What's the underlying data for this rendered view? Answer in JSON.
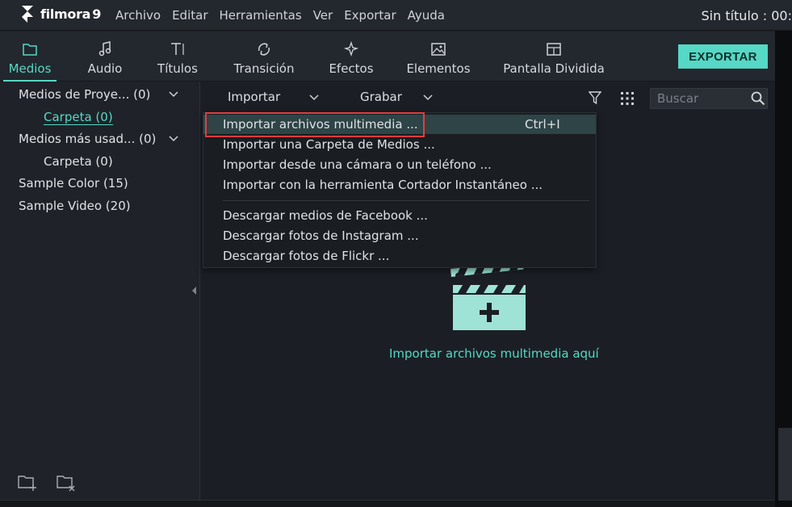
{
  "app": {
    "logo_text": "filmora",
    "logo_version": "9",
    "document_title": "Sin título : 00:"
  },
  "menubar": [
    "Archivo",
    "Editar",
    "Herramientas",
    "Ver",
    "Exportar",
    "Ayuda"
  ],
  "tabs": [
    {
      "label": "Medios",
      "icon": "folder-icon",
      "active": true
    },
    {
      "label": "Audio",
      "icon": "music-note-icon",
      "active": false
    },
    {
      "label": "Títulos",
      "icon": "text-icon",
      "active": false
    },
    {
      "label": "Transición",
      "icon": "transition-icon",
      "active": false
    },
    {
      "label": "Efectos",
      "icon": "effects-icon",
      "active": false
    },
    {
      "label": "Elementos",
      "icon": "image-icon",
      "active": false
    },
    {
      "label": "Pantalla Dividida",
      "icon": "split-screen-icon",
      "active": false
    }
  ],
  "export_button": "EXPORTAR",
  "sidebar": {
    "items": [
      {
        "label": "Medios de Proye... (0)",
        "expandable": true
      },
      {
        "label": "Carpeta (0)",
        "selected": true
      },
      {
        "label": "Medios más usad... (0)",
        "expandable": true
      },
      {
        "label": "Carpeta (0)"
      },
      {
        "label": "Sample Color (15)"
      },
      {
        "label": "Sample Video (20)"
      }
    ]
  },
  "toolbar": {
    "import_label": "Importar",
    "record_label": "Grabar",
    "search_placeholder": "Buscar"
  },
  "dropdown": {
    "items": [
      {
        "label": "Importar archivos multimedia ...",
        "shortcut": "Ctrl+I",
        "highlighted": true
      },
      {
        "label": "Importar una Carpeta de Medios ..."
      },
      {
        "label": "Importar desde una cámara o un teléfono ..."
      },
      {
        "label": "Importar con la herramienta Cortador Instantáneo ..."
      },
      {
        "label": "Descargar medios de Facebook ..."
      },
      {
        "label": "Descargar fotos de Instagram ..."
      },
      {
        "label": "Descargar fotos de Flickr ..."
      }
    ]
  },
  "drop_zone": {
    "text": "Importar archivos multimedia aquí"
  },
  "colors": {
    "accent": "#55d8c5",
    "highlight_border": "#e33d3d"
  }
}
